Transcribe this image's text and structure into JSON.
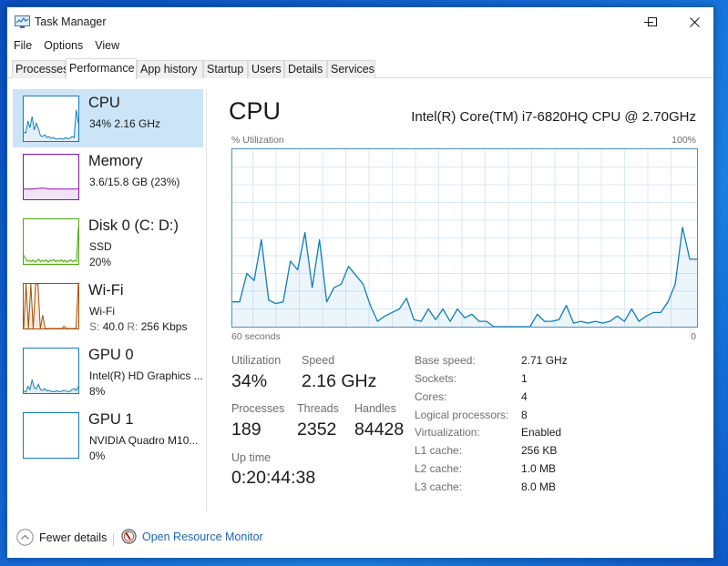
{
  "window": {
    "title": "Task Manager",
    "controls": {
      "minimize": "minimize-icon",
      "maximize": "maximize-icon",
      "close": "close-icon"
    }
  },
  "menu": [
    "File",
    "Options",
    "View"
  ],
  "tabs": [
    {
      "label": "Processes",
      "active": false
    },
    {
      "label": "Performance",
      "active": true
    },
    {
      "label": "App history",
      "active": false
    },
    {
      "label": "Startup",
      "active": false
    },
    {
      "label": "Users",
      "active": false
    },
    {
      "label": "Details",
      "active": false
    },
    {
      "label": "Services",
      "active": false
    }
  ],
  "sidebar": {
    "items": [
      {
        "id": "cpu",
        "title": "CPU",
        "line1": "34%  2.16 GHz",
        "line2": "",
        "selected": true,
        "color": "#117dbb",
        "spark": [
          20,
          18,
          45,
          30,
          55,
          25,
          40,
          28,
          12,
          10,
          14,
          8,
          10,
          6,
          8,
          5,
          4,
          6,
          5,
          4,
          8,
          5,
          6,
          10,
          8,
          70,
          40
        ]
      },
      {
        "id": "memory",
        "title": "Memory",
        "line1": "3.6/15.8 GB (23%)",
        "line2": "",
        "selected": false,
        "color": "#8b12ae",
        "spark": [
          23,
          23,
          23,
          23,
          24,
          24,
          25,
          25,
          24,
          23,
          23,
          23,
          23,
          23,
          23,
          23,
          23,
          23,
          23,
          23
        ]
      },
      {
        "id": "disk0",
        "title": "Disk 0 (C: D:)",
        "line1": "SSD",
        "line2": "20%",
        "selected": false,
        "color": "#4da60c",
        "spark": [
          20,
          12,
          6,
          8,
          5,
          9,
          4,
          7,
          10,
          5,
          8,
          6,
          9,
          4,
          8,
          7,
          10,
          5,
          8,
          6,
          9,
          5,
          8,
          4,
          7,
          9,
          5,
          8,
          6,
          80
        ]
      },
      {
        "id": "wifi",
        "title": "Wi-Fi",
        "line1": "Wi-Fi",
        "line2_label_s": "S:",
        "line2_val_s": "40.0",
        "line2_label_r": "R:",
        "line2_val_r": "256 Kbps",
        "selected": false,
        "color": "#a74f01",
        "spark": [
          0,
          100,
          0,
          100,
          0,
          100,
          100,
          0,
          30,
          0,
          0,
          0,
          0,
          0,
          0,
          0,
          0,
          5,
          0,
          0,
          0,
          0,
          0,
          100
        ]
      },
      {
        "id": "gpu0",
        "title": "GPU 0",
        "line1": "Intel(R) HD Graphics ...",
        "line2": "8%",
        "selected": false,
        "color": "#117dbb",
        "spark": [
          5,
          2,
          15,
          8,
          30,
          12,
          10,
          20,
          8,
          6,
          10,
          5,
          6,
          4,
          3,
          4,
          5,
          3,
          4,
          6,
          5,
          3,
          4,
          8,
          10,
          6,
          15
        ]
      },
      {
        "id": "gpu1",
        "title": "GPU 1",
        "line1": "NVIDIA Quadro M10...",
        "line2": "0%",
        "selected": false,
        "color": "#117dbb",
        "spark": []
      }
    ]
  },
  "main": {
    "title": "CPU",
    "model": "Intel(R) Core(TM) i7-6820HQ CPU @ 2.70GHz",
    "graph_label_top_left": "% Utilization",
    "graph_label_top_right": "100%",
    "graph_label_bottom_left": "60 seconds",
    "graph_label_bottom_right": "0",
    "accent_color": "#117dbb",
    "stats": {
      "utilization_label": "Utilization",
      "utilization": "34%",
      "speed_label": "Speed",
      "speed": "2.16 GHz",
      "processes_label": "Processes",
      "processes": "189",
      "threads_label": "Threads",
      "threads": "2352",
      "handles_label": "Handles",
      "handles": "84428",
      "uptime_label": "Up time",
      "uptime": "0:20:44:38"
    },
    "specs": [
      {
        "label": "Base speed:",
        "value": "2.71 GHz"
      },
      {
        "label": "Sockets:",
        "value": "1"
      },
      {
        "label": "Cores:",
        "value": "4"
      },
      {
        "label": "Logical processors:",
        "value": "8"
      },
      {
        "label": "Virtualization:",
        "value": "Enabled"
      },
      {
        "label": "L1 cache:",
        "value": "256 KB"
      },
      {
        "label": "L2 cache:",
        "value": "1.0 MB"
      },
      {
        "label": "L3 cache:",
        "value": "8.0 MB"
      }
    ]
  },
  "chart_data": {
    "type": "area",
    "title": "CPU % Utilization",
    "xlabel": "60 seconds",
    "ylabel": "% Utilization",
    "xlim": [
      60,
      0
    ],
    "ylim": [
      0,
      100
    ],
    "grid": true,
    "series": [
      {
        "name": "CPU",
        "values": [
          14,
          14,
          30,
          26,
          49,
          15,
          13,
          14,
          37,
          32,
          53,
          22,
          49,
          14,
          22,
          24,
          34,
          29,
          24,
          12,
          3,
          6,
          8,
          10,
          16,
          4,
          3,
          10,
          4,
          10,
          3,
          10,
          5,
          7,
          3,
          3,
          0,
          0,
          0,
          0,
          0,
          0,
          7,
          3,
          3,
          4,
          12,
          2,
          3,
          2,
          3,
          2,
          3,
          6,
          3,
          10,
          3,
          6,
          8,
          8,
          14,
          24,
          56,
          38,
          38
        ]
      }
    ]
  },
  "footer": {
    "fewer_details": "Fewer details",
    "open_resource_monitor": "Open Resource Monitor"
  }
}
